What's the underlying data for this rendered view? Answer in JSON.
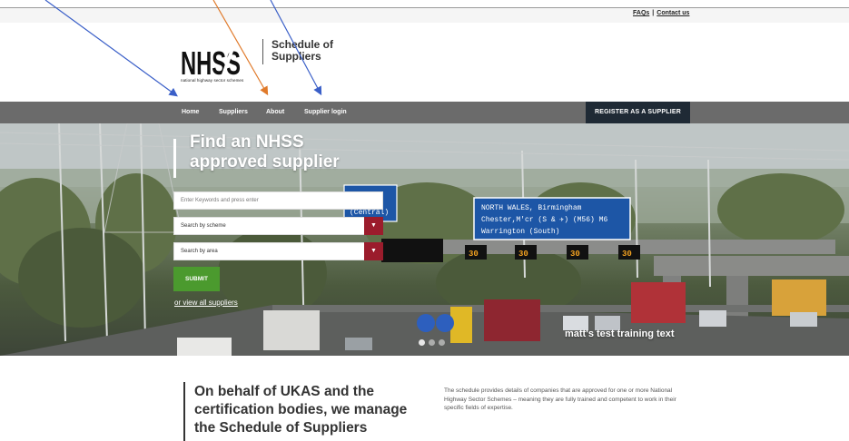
{
  "top_links": {
    "faqs": "FAQs",
    "separator": "|",
    "contact": "Contact us"
  },
  "logo": {
    "letters": "NHSS",
    "subtitle": "national highway sector schemes"
  },
  "site_title": {
    "line1": "Schedule of",
    "line2": "Suppliers"
  },
  "nav": {
    "items": [
      "Home",
      "Suppliers",
      "About",
      "Supplier login"
    ],
    "register": "REGISTER AS A SUPPLIER"
  },
  "hero": {
    "title_line1": "Find an NHSS",
    "title_line2": "approved supplier",
    "search_placeholder": "Enter Keywords and press enter",
    "scheme_select": "Search by scheme",
    "area_select": "Search by area",
    "submit": "SUBMIT",
    "view_all": "or view all suppliers",
    "caption": "matt's test training text",
    "slides": 3,
    "active_slide": 1
  },
  "sign": {
    "line1": "NORTH WALES, Birmingham",
    "line2": "Chester,M'cr (S & ✈) (M56)  M6",
    "line3": "Warrington (South)",
    "small": "(Central)",
    "speeds": [
      "30",
      "30",
      "30",
      "30"
    ]
  },
  "about": {
    "heading_line1": "On behalf of UKAS and the",
    "heading_line2": "certification bodies, we manage",
    "heading_line3": "the Schedule of Suppliers",
    "text": "The schedule provides details of companies that are approved for one or more National Highway Sector Schemes – meaning they are fully trained and competent to work in their specific fields of expertise."
  },
  "colors": {
    "nav_bg": "#6b6b6b",
    "register_bg": "#1f2a35",
    "select_button": "#9b1c2c",
    "submit": "#4b9a2e",
    "arrow_blue": "#3a5fc8",
    "arrow_orange": "#e07a2a"
  }
}
